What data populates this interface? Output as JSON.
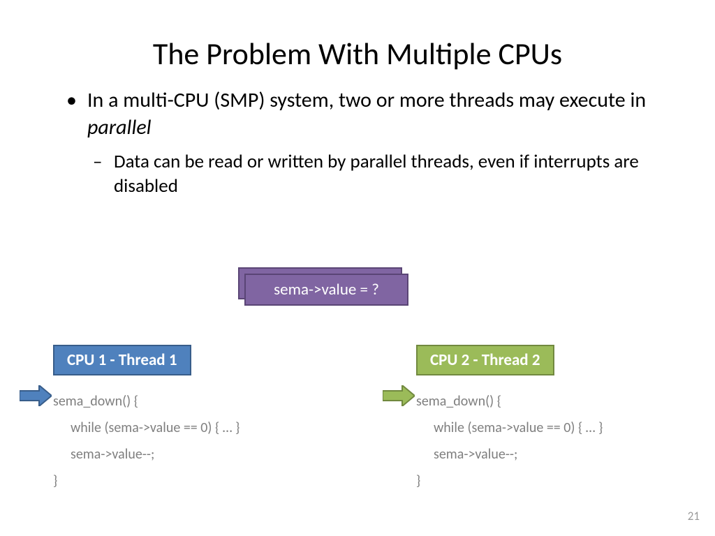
{
  "title": "The Problem With Multiple CPUs",
  "bullets": {
    "main_pre": "In a multi-CPU (SMP) system, two or more threads may execute in ",
    "main_em": "parallel",
    "sub": "Data can be read or written by parallel threads, even if interrupts are disabled"
  },
  "sema_box": "sema->value = ?",
  "cpu1": {
    "header": "CPU 1 - Thread 1",
    "code_l1": "sema_down() {",
    "code_l2": "while (sema->value == 0) { … }",
    "code_l3": "sema->value--;",
    "code_l4": "}"
  },
  "cpu2": {
    "header": "CPU 2 - Thread 2",
    "code_l1": "sema_down() {",
    "code_l2": "while (sema->value == 0) { … }",
    "code_l3": "sema->value--;",
    "code_l4": "}"
  },
  "page_number": "21",
  "colors": {
    "arrow_blue_fill": "#4f81bd",
    "arrow_blue_stroke": "#385d8a",
    "arrow_green_fill": "#9bbb59",
    "arrow_green_stroke": "#71893f"
  }
}
